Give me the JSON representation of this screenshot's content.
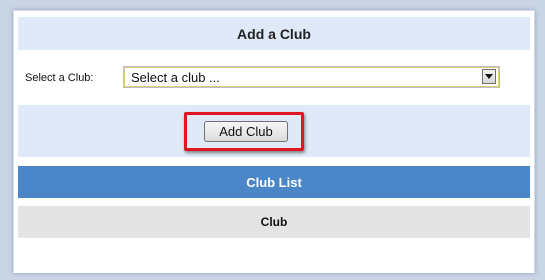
{
  "add_club": {
    "title": "Add a Club",
    "select_label": "Select a Club:",
    "select_value": "Select a club ...",
    "button_label": "Add Club"
  },
  "club_list": {
    "title": "Club List",
    "column_header": "Club",
    "rows": []
  },
  "colors": {
    "section_background": "#dfe9f7",
    "list_header_background": "#4b86c8",
    "column_header_background": "#e4e4e4",
    "highlight_border": "#e01620"
  },
  "icons": {
    "select_arrow": "chevron-down-icon"
  }
}
